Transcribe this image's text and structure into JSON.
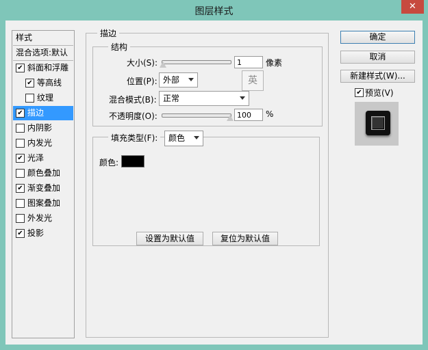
{
  "window": {
    "title": "图层样式",
    "close_glyph": "✕"
  },
  "styles_list": {
    "items": [
      {
        "label": "样式",
        "checkbox": null,
        "selected": false
      },
      {
        "label": "混合选项:默认",
        "checkbox": null,
        "selected": false
      },
      {
        "label": "斜面和浮雕",
        "checkbox": true,
        "selected": false
      },
      {
        "label": "等高线",
        "checkbox": true,
        "selected": false
      },
      {
        "label": "纹理",
        "checkbox": false,
        "selected": false
      },
      {
        "label": "描边",
        "checkbox": true,
        "selected": true
      },
      {
        "label": "内阴影",
        "checkbox": false,
        "selected": false
      },
      {
        "label": "内发光",
        "checkbox": false,
        "selected": false
      },
      {
        "label": "光泽",
        "checkbox": true,
        "selected": false
      },
      {
        "label": "颜色叠加",
        "checkbox": false,
        "selected": false
      },
      {
        "label": "渐变叠加",
        "checkbox": true,
        "selected": false
      },
      {
        "label": "图案叠加",
        "checkbox": false,
        "selected": false
      },
      {
        "label": "外发光",
        "checkbox": false,
        "selected": false
      },
      {
        "label": "投影",
        "checkbox": true,
        "selected": false
      }
    ]
  },
  "stroke": {
    "group_title": "描边",
    "structure_title": "结构",
    "size_label": "大小(S):",
    "size_value": "1",
    "size_unit": "像素",
    "size_fraction": 0.0,
    "ime_indicator": "英",
    "position_label": "位置(P):",
    "position_value": "外部",
    "blend_label": "混合模式(B):",
    "blend_value": "正常",
    "opacity_label": "不透明度(O):",
    "opacity_value": "100",
    "opacity_unit": "%",
    "opacity_fraction": 1.0,
    "fill_type_label": "填充类型(F):",
    "fill_type_value": "颜色",
    "color_label": "颜色:",
    "color_hex": "#000000"
  },
  "buttons": {
    "set_default": "设置为默认值",
    "reset_default": "复位为默认值",
    "ok": "确定",
    "cancel": "取消",
    "new_style": "新建样式(W)...",
    "preview_label": "预览(V)",
    "preview_checked": true
  }
}
